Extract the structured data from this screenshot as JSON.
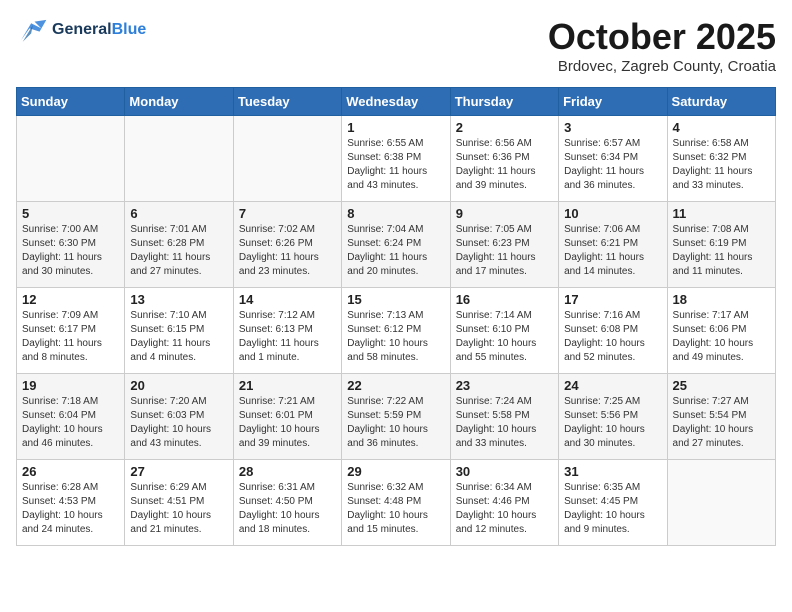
{
  "header": {
    "logo_line1": "General",
    "logo_line2": "Blue",
    "title": "October 2025",
    "subtitle": "Brdovec, Zagreb County, Croatia"
  },
  "weekdays": [
    "Sunday",
    "Monday",
    "Tuesday",
    "Wednesday",
    "Thursday",
    "Friday",
    "Saturday"
  ],
  "weeks": [
    [
      {
        "num": "",
        "info": ""
      },
      {
        "num": "",
        "info": ""
      },
      {
        "num": "",
        "info": ""
      },
      {
        "num": "1",
        "info": "Sunrise: 6:55 AM\nSunset: 6:38 PM\nDaylight: 11 hours\nand 43 minutes."
      },
      {
        "num": "2",
        "info": "Sunrise: 6:56 AM\nSunset: 6:36 PM\nDaylight: 11 hours\nand 39 minutes."
      },
      {
        "num": "3",
        "info": "Sunrise: 6:57 AM\nSunset: 6:34 PM\nDaylight: 11 hours\nand 36 minutes."
      },
      {
        "num": "4",
        "info": "Sunrise: 6:58 AM\nSunset: 6:32 PM\nDaylight: 11 hours\nand 33 minutes."
      }
    ],
    [
      {
        "num": "5",
        "info": "Sunrise: 7:00 AM\nSunset: 6:30 PM\nDaylight: 11 hours\nand 30 minutes."
      },
      {
        "num": "6",
        "info": "Sunrise: 7:01 AM\nSunset: 6:28 PM\nDaylight: 11 hours\nand 27 minutes."
      },
      {
        "num": "7",
        "info": "Sunrise: 7:02 AM\nSunset: 6:26 PM\nDaylight: 11 hours\nand 23 minutes."
      },
      {
        "num": "8",
        "info": "Sunrise: 7:04 AM\nSunset: 6:24 PM\nDaylight: 11 hours\nand 20 minutes."
      },
      {
        "num": "9",
        "info": "Sunrise: 7:05 AM\nSunset: 6:23 PM\nDaylight: 11 hours\nand 17 minutes."
      },
      {
        "num": "10",
        "info": "Sunrise: 7:06 AM\nSunset: 6:21 PM\nDaylight: 11 hours\nand 14 minutes."
      },
      {
        "num": "11",
        "info": "Sunrise: 7:08 AM\nSunset: 6:19 PM\nDaylight: 11 hours\nand 11 minutes."
      }
    ],
    [
      {
        "num": "12",
        "info": "Sunrise: 7:09 AM\nSunset: 6:17 PM\nDaylight: 11 hours\nand 8 minutes."
      },
      {
        "num": "13",
        "info": "Sunrise: 7:10 AM\nSunset: 6:15 PM\nDaylight: 11 hours\nand 4 minutes."
      },
      {
        "num": "14",
        "info": "Sunrise: 7:12 AM\nSunset: 6:13 PM\nDaylight: 11 hours\nand 1 minute."
      },
      {
        "num": "15",
        "info": "Sunrise: 7:13 AM\nSunset: 6:12 PM\nDaylight: 10 hours\nand 58 minutes."
      },
      {
        "num": "16",
        "info": "Sunrise: 7:14 AM\nSunset: 6:10 PM\nDaylight: 10 hours\nand 55 minutes."
      },
      {
        "num": "17",
        "info": "Sunrise: 7:16 AM\nSunset: 6:08 PM\nDaylight: 10 hours\nand 52 minutes."
      },
      {
        "num": "18",
        "info": "Sunrise: 7:17 AM\nSunset: 6:06 PM\nDaylight: 10 hours\nand 49 minutes."
      }
    ],
    [
      {
        "num": "19",
        "info": "Sunrise: 7:18 AM\nSunset: 6:04 PM\nDaylight: 10 hours\nand 46 minutes."
      },
      {
        "num": "20",
        "info": "Sunrise: 7:20 AM\nSunset: 6:03 PM\nDaylight: 10 hours\nand 43 minutes."
      },
      {
        "num": "21",
        "info": "Sunrise: 7:21 AM\nSunset: 6:01 PM\nDaylight: 10 hours\nand 39 minutes."
      },
      {
        "num": "22",
        "info": "Sunrise: 7:22 AM\nSunset: 5:59 PM\nDaylight: 10 hours\nand 36 minutes."
      },
      {
        "num": "23",
        "info": "Sunrise: 7:24 AM\nSunset: 5:58 PM\nDaylight: 10 hours\nand 33 minutes."
      },
      {
        "num": "24",
        "info": "Sunrise: 7:25 AM\nSunset: 5:56 PM\nDaylight: 10 hours\nand 30 minutes."
      },
      {
        "num": "25",
        "info": "Sunrise: 7:27 AM\nSunset: 5:54 PM\nDaylight: 10 hours\nand 27 minutes."
      }
    ],
    [
      {
        "num": "26",
        "info": "Sunrise: 6:28 AM\nSunset: 4:53 PM\nDaylight: 10 hours\nand 24 minutes."
      },
      {
        "num": "27",
        "info": "Sunrise: 6:29 AM\nSunset: 4:51 PM\nDaylight: 10 hours\nand 21 minutes."
      },
      {
        "num": "28",
        "info": "Sunrise: 6:31 AM\nSunset: 4:50 PM\nDaylight: 10 hours\nand 18 minutes."
      },
      {
        "num": "29",
        "info": "Sunrise: 6:32 AM\nSunset: 4:48 PM\nDaylight: 10 hours\nand 15 minutes."
      },
      {
        "num": "30",
        "info": "Sunrise: 6:34 AM\nSunset: 4:46 PM\nDaylight: 10 hours\nand 12 minutes."
      },
      {
        "num": "31",
        "info": "Sunrise: 6:35 AM\nSunset: 4:45 PM\nDaylight: 10 hours\nand 9 minutes."
      },
      {
        "num": "",
        "info": ""
      }
    ]
  ]
}
